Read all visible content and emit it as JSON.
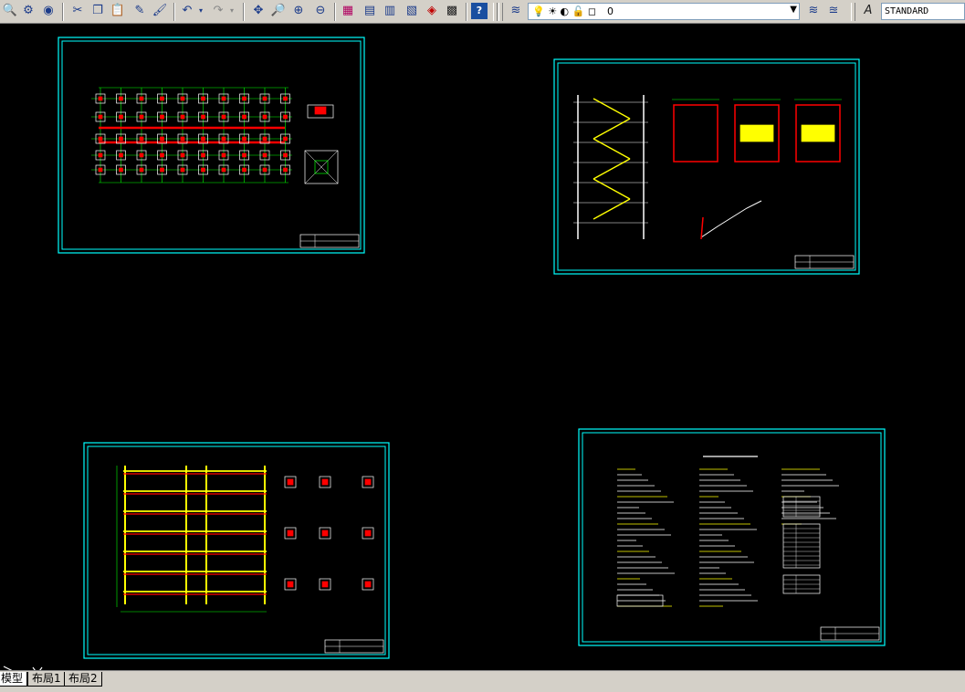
{
  "toolbar": {
    "layer_value": "0",
    "text_style": "STANDARD"
  },
  "tabs": [
    "模型",
    "布局1",
    "布局2"
  ],
  "colors": {
    "frame": "#00ffff",
    "axis": "#00ff00",
    "beam": "#ff0000",
    "wall": "#ffff00",
    "line": "#ffffff"
  },
  "icons": {
    "standard": [
      "open-icon",
      "save-icon",
      "plot-icon",
      "cut-icon",
      "copy-icon",
      "paste-icon",
      "match-prop-icon",
      "brush-icon",
      "undo-icon",
      "redo-icon",
      "pan-icon",
      "zoom-realtime-icon",
      "zoom-window-icon",
      "zoom-previous-icon",
      "properties-icon",
      "design-center-icon",
      "tool-palette-icon",
      "sheet-set-icon",
      "markup-icon",
      "calculator-icon",
      "help-icon"
    ],
    "layers": [
      "layer-manager-icon",
      "layer-state-icon"
    ]
  }
}
